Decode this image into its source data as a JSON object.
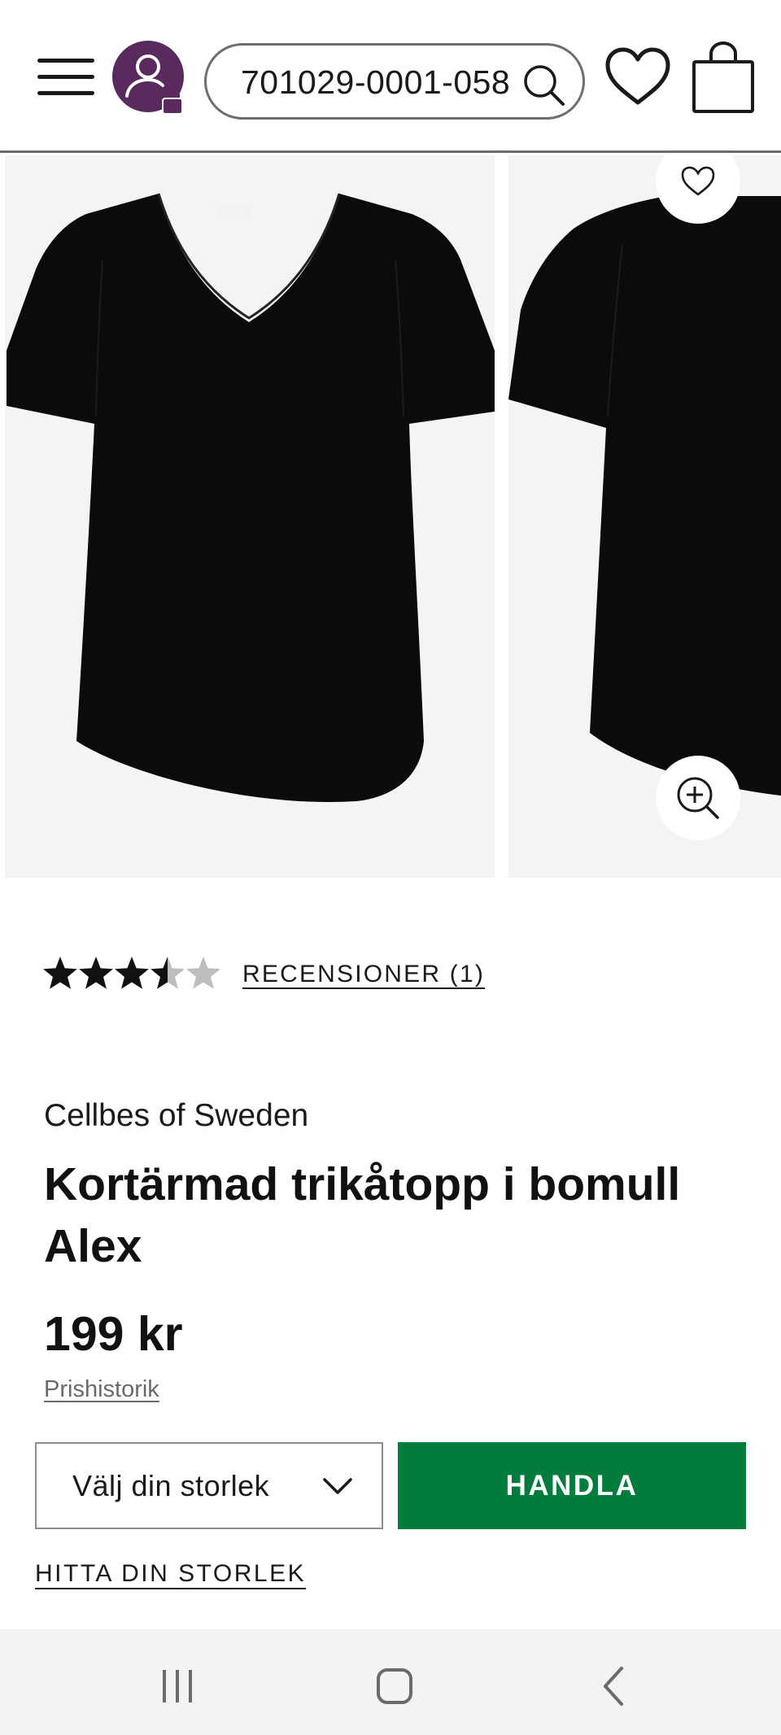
{
  "header": {
    "search_value": "701029-0001-058",
    "menu_icon": "hamburger-menu-icon",
    "account_icon": "user-lock-icon",
    "wishlist_icon": "heart-icon",
    "cart_icon": "shopping-bag-icon",
    "accent_color": "#5a2a5e"
  },
  "gallery": {
    "image_1": "black-vneck-tshirt-front",
    "image_2": "black-vneck-tshirt-side",
    "wishlist_icon": "heart-icon",
    "zoom_icon": "zoom-in-icon"
  },
  "rating": {
    "value": 3.5,
    "max": 5,
    "reviews_label": "RECENSIONER (1)"
  },
  "product": {
    "brand": "Cellbes of Sweden",
    "title": "Kortärmad trikåtopp i bomull Alex",
    "price": "199 kr",
    "price_history_label": "Prishistorik"
  },
  "actions": {
    "size_placeholder": "Välj din storlek",
    "buy_label": "HANDLA",
    "buy_color": "#017c3d",
    "find_size_label": "HITTA DIN STORLEK"
  },
  "navbar": {
    "recents_icon": "recent-apps-icon",
    "home_icon": "home-icon",
    "back_icon": "back-icon"
  }
}
